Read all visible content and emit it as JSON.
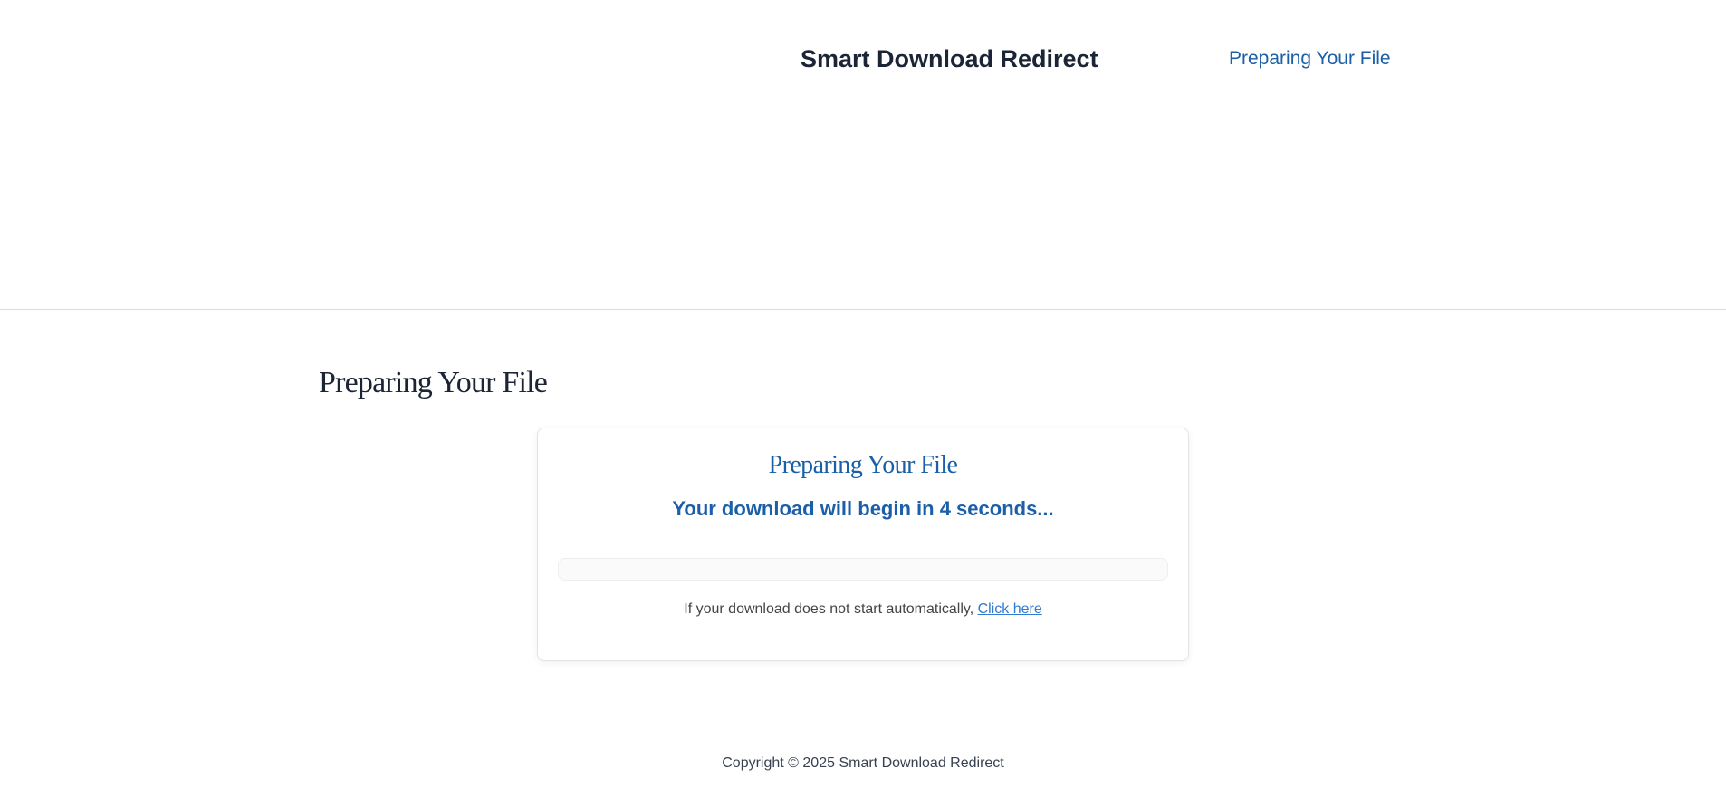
{
  "header": {
    "site_title": "Smart Download Redirect",
    "nav_link": "Preparing Your File"
  },
  "main": {
    "page_heading": "Preparing Your File",
    "card": {
      "title": "Preparing Your File",
      "countdown": "Your download will begin in 4 seconds...",
      "progress_fraction": 0,
      "fallback_text": "If your download does not start automatically, ",
      "fallback_link": "Click here"
    }
  },
  "footer": {
    "copyright": "Copyright © 2025 Smart Download Redirect"
  },
  "colors": {
    "accent": "#1a5fa8",
    "link": "#2f7bd2",
    "heading": "#1b2536"
  }
}
